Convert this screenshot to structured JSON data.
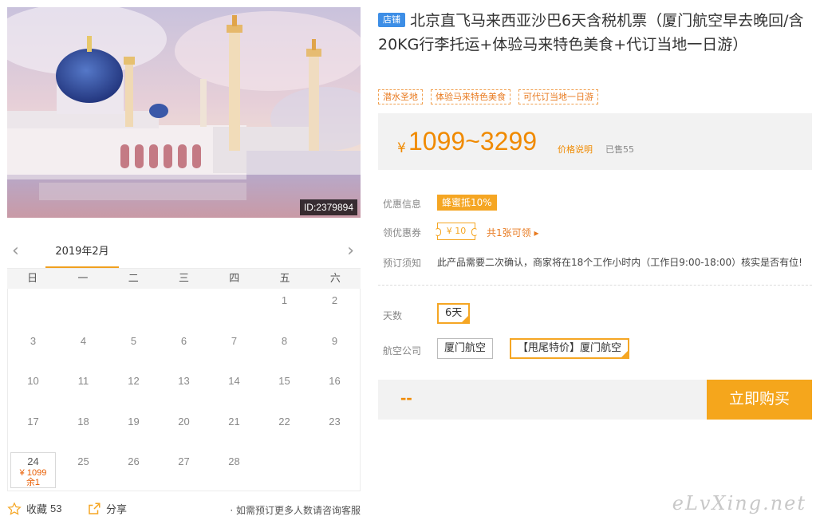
{
  "hero": {
    "image_id": "ID:2379894"
  },
  "calendar": {
    "month": "2019年2月",
    "prev_icon": "chevron-left-icon",
    "next_icon": "chevron-right-icon",
    "weekdays": [
      "日",
      "一",
      "二",
      "三",
      "四",
      "五",
      "六"
    ],
    "days": {
      "d1": "1",
      "d2": "2",
      "d3": "3",
      "d4": "4",
      "d5": "5",
      "d6": "6",
      "d7": "7",
      "d8": "8",
      "d9": "9",
      "d10": "10",
      "d11": "11",
      "d12": "12",
      "d13": "13",
      "d14": "14",
      "d15": "15",
      "d16": "16",
      "d17": "17",
      "d18": "18",
      "d19": "19",
      "d20": "20",
      "d21": "21",
      "d22": "22",
      "d23": "23",
      "d24": "24",
      "d25": "25",
      "d26": "26",
      "d27": "27",
      "d28": "28"
    },
    "d24_price": "¥ 1099",
    "d24_left": "余1"
  },
  "actions": {
    "favorite_label": "收藏",
    "favorite_count": "53",
    "share_label": "分享",
    "consult_text": "· 如需预订更多人数请咨询客服"
  },
  "product": {
    "shop_badge": "店铺",
    "title": "北京直飞马来西亚沙巴6天含税机票（厦门航空早去晚回/含20KG行李托运+体验马来特色美食+代订当地一日游）",
    "tags": [
      "潜水圣地",
      "体验马来特色美食",
      "可代订当地一日游"
    ]
  },
  "price": {
    "currency": "¥",
    "range": "1099~3299",
    "note_link": "价格说明",
    "sold": "已售55"
  },
  "info": {
    "promo_label": "优惠信息",
    "promo_badge": "蜂蜜抵10%",
    "coupon_label": "领优惠券",
    "coupon_value": "¥ 10",
    "coupon_link": "共1张可领 ▸",
    "notice_label": "预订须知",
    "notice_text": "此产品需要二次确认，商家将在18个工作小时内（工作日9:00-18:00）核实是否有位!"
  },
  "options": {
    "days_label": "天数",
    "days_value": "6天",
    "airline_label": "航空公司",
    "airline_1": "厦门航空",
    "airline_2": "【甩尾特价】厦门航空"
  },
  "buy": {
    "total": "--",
    "button": "立即购买"
  },
  "watermark": "eLvXing.net",
  "colors": {
    "accent": "#f5a623",
    "price": "#f08a00",
    "shop_badge": "#3d8ee6"
  }
}
